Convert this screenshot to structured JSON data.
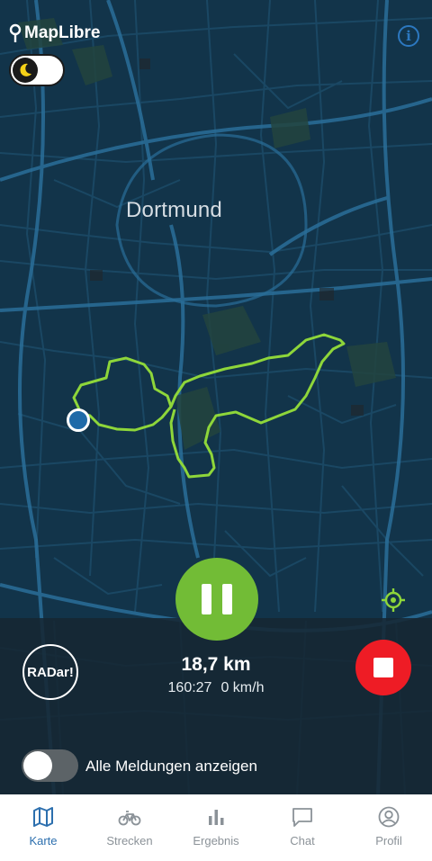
{
  "map": {
    "attribution": "MapLibre",
    "city": "Dortmund",
    "route_color": "#8ed63a",
    "background_color": "#12344a"
  },
  "tracking": {
    "distance": "18,7 km",
    "duration": "160:27",
    "speed": "0 km/h",
    "radar_label": "RADar!",
    "pause_color": "#72bc36",
    "stop_color": "#ee1c25"
  },
  "reports": {
    "label": "Alle Meldungen anzeigen",
    "enabled": false
  },
  "theme": {
    "dark_mode": true
  },
  "tabs": [
    {
      "label": "Karte",
      "icon": "map-icon",
      "active": true
    },
    {
      "label": "Strecken",
      "icon": "bike-icon",
      "active": false
    },
    {
      "label": "Ergebnis",
      "icon": "bar-chart-icon",
      "active": false
    },
    {
      "label": "Chat",
      "icon": "chat-icon",
      "active": false
    },
    {
      "label": "Profil",
      "icon": "profile-icon",
      "active": false
    }
  ],
  "accent_color": "#2c6fae"
}
